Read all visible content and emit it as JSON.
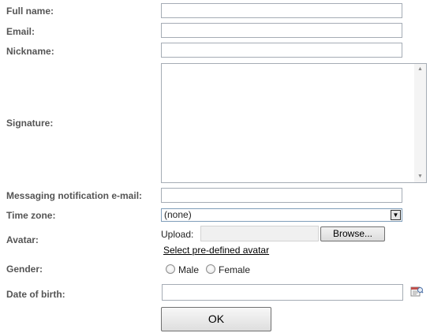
{
  "form": {
    "full_name": {
      "label": "Full name:",
      "value": ""
    },
    "email": {
      "label": "Email:",
      "value": ""
    },
    "nickname": {
      "label": "Nickname:",
      "value": ""
    },
    "signature": {
      "label": "Signature:",
      "value": ""
    },
    "messaging_email": {
      "label": "Messaging notification e-mail:",
      "value": ""
    },
    "time_zone": {
      "label": "Time zone:",
      "selected": "(none)"
    },
    "avatar": {
      "label": "Avatar:",
      "upload_label": "Upload:",
      "browse_label": "Browse...",
      "predefined_link": "Select pre-defined avatar"
    },
    "gender": {
      "label": "Gender:",
      "options": [
        "Male",
        "Female"
      ],
      "selected": null
    },
    "date_of_birth": {
      "label": "Date of birth:",
      "value": ""
    },
    "ok_label": "OK"
  },
  "icons": {
    "calendar": "calendar-icon",
    "scroll_up": "scroll-up-arrow-icon",
    "scroll_down": "scroll-down-arrow-icon",
    "dropdown": "chevron-down-icon"
  },
  "colors": {
    "label_text": "#555555",
    "input_border": "#a5acb5",
    "button_gradient_top": "#f7f7f7",
    "button_gradient_bottom": "#dedede"
  }
}
